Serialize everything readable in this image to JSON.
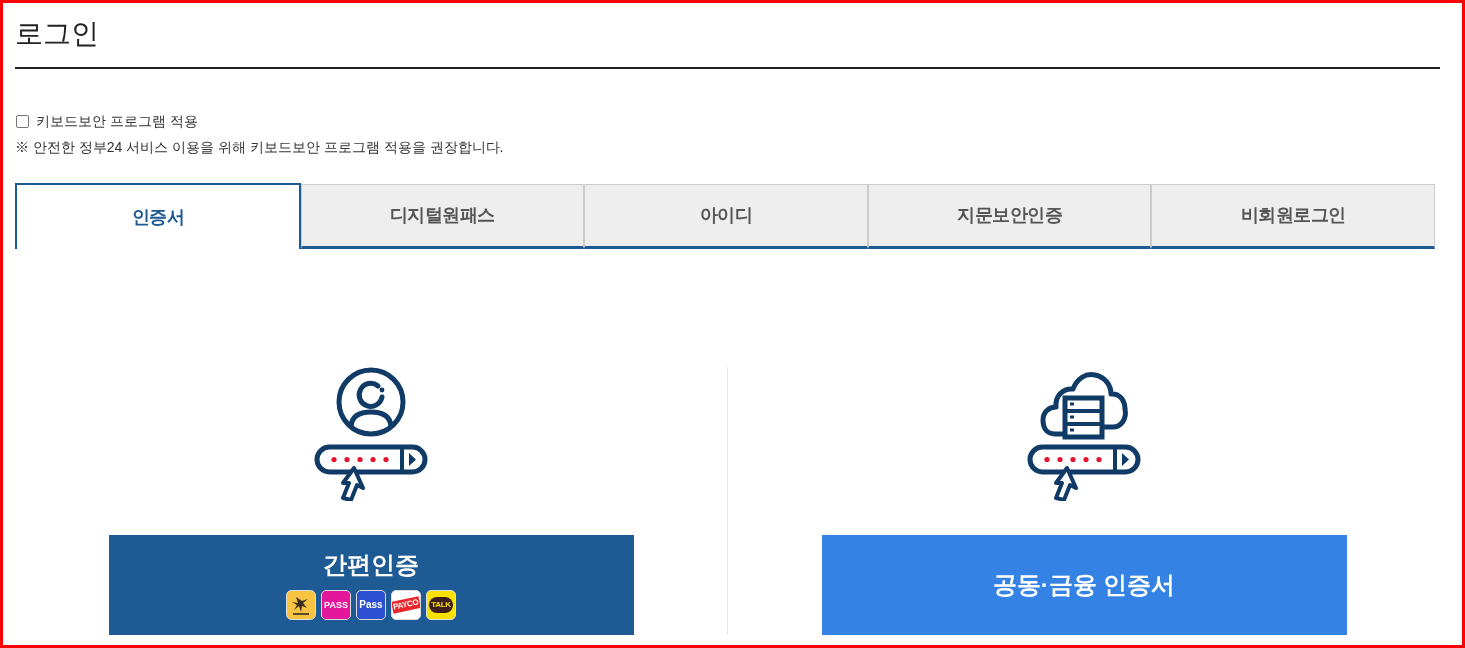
{
  "page": {
    "title": "로그인"
  },
  "keyboard_security": {
    "label": "키보드보안 프로그램 적용",
    "checked": false
  },
  "notice": "※ 안전한 정부24 서비스 이용을 위해 키보드보안 프로그램 적용을 권장합니다.",
  "tabs": [
    {
      "label": "인증서",
      "selected": true
    },
    {
      "label": "디지털원패스",
      "selected": false
    },
    {
      "label": "아이디",
      "selected": false
    },
    {
      "label": "지문보안인증",
      "selected": false
    },
    {
      "label": "비회원로그인",
      "selected": false
    }
  ],
  "login_options": [
    {
      "kind": "simple",
      "label": "간편인증",
      "providers": [
        {
          "kind": "star"
        },
        {
          "kind": "pass",
          "label": "PASS"
        },
        {
          "kind": "samsung",
          "label": "Pass"
        },
        {
          "kind": "payco",
          "label": "PAYCO"
        },
        {
          "kind": "talk",
          "label": "TALK"
        }
      ]
    },
    {
      "kind": "certificate",
      "label": "공동·금융 인증서"
    }
  ]
}
